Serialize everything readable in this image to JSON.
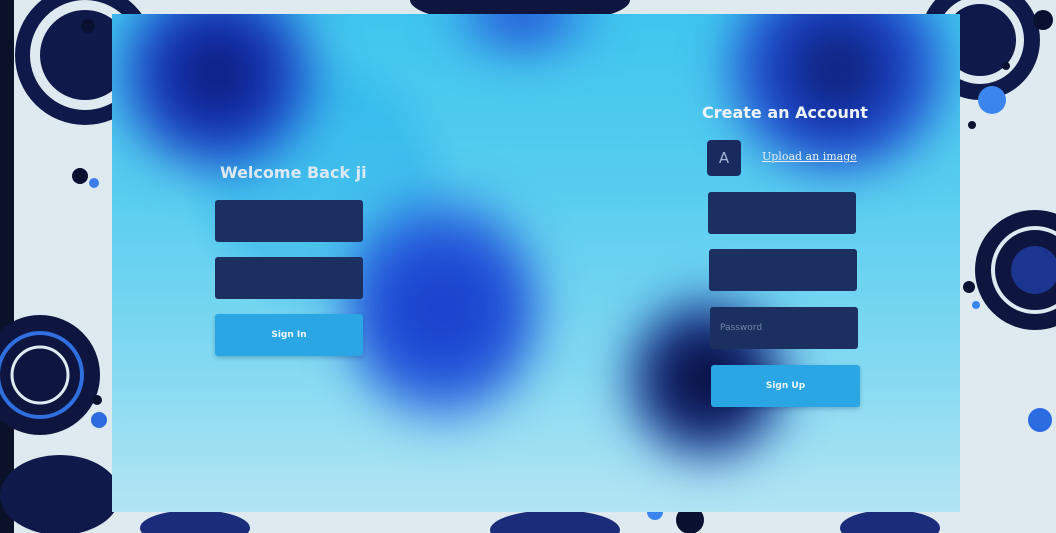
{
  "login": {
    "title": "Welcome Back ji",
    "username_placeholder": "",
    "password_placeholder": "",
    "submit_label": "Sign In"
  },
  "register": {
    "title": "Create an Account",
    "avatar_letter": "A",
    "upload_label": "Upload an image",
    "field1_placeholder": "",
    "field2_placeholder": "",
    "password_placeholder": "Password",
    "submit_label": "Sign Up"
  },
  "colors": {
    "input_bg": "#1b2f60",
    "button_bg": "#2aa6e4",
    "avatar_bg": "#1a2a5e",
    "glass_tint": "#57cdef"
  }
}
